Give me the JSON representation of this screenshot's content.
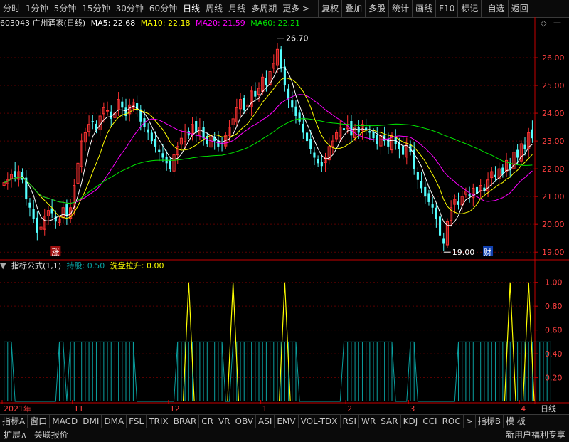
{
  "topbar": {
    "items": [
      "分时",
      "1分钟",
      "5分钟",
      "15分钟",
      "30分钟",
      "60分钟",
      "日线",
      "周线",
      "月线",
      "多周期",
      "更多 >"
    ],
    "active": "日线",
    "right_items": [
      "复权",
      "叠加",
      "多股",
      "统计",
      "画线",
      "F10",
      "标记",
      "-自选",
      "返回"
    ],
    "diamond_icon": "diamond-icon",
    "minimize_icon": "minimize-icon"
  },
  "info": {
    "code_name": "603043 广州酒家(日线)",
    "ma5": "MA5: 22.68",
    "ma10": "MA10: 22.18",
    "ma20": "MA20: 21.59",
    "ma60": "MA60: 22.21"
  },
  "indicator": {
    "name": "指标公式(1,1)",
    "hold_label": "持股: 0.50",
    "wash_label": "洗盘拉升: 0.00"
  },
  "markers": {
    "zhang": "涨",
    "cai": "财",
    "high": "26.70",
    "low": "19.00"
  },
  "colors": {
    "up": "#ff3232",
    "down": "#54ffff",
    "ma5": "#ffffff",
    "ma10": "#ffff00",
    "ma20": "#ff00ff",
    "ma60": "#00e600",
    "axis": "#c80000",
    "grid": "#5a0000",
    "hold": "#0aa0a0",
    "wash": "#ffff00"
  },
  "chart_data": {
    "type": "candlestick",
    "price_axis": {
      "ticks": [
        "26.00",
        "25.00",
        "24.00",
        "23.00",
        "22.00",
        "21.00",
        "20.00",
        "19.00"
      ],
      "range": [
        18.8,
        27.0
      ]
    },
    "indicator_axis": {
      "ticks": [
        "1.00",
        "0.80",
        "0.60",
        "0.40",
        "0.20"
      ],
      "range": [
        0,
        1.1
      ]
    },
    "time_labels": [
      "2021年",
      "11",
      "12",
      "1",
      "2",
      "3",
      "4"
    ],
    "time_label_index": [
      0,
      19,
      45,
      70,
      93,
      110,
      140
    ],
    "close_series": [
      21.5,
      21.6,
      21.8,
      21.7,
      21.9,
      21.6,
      20.9,
      20.6,
      20.2,
      19.7,
      19.9,
      20.3,
      20.5,
      20.4,
      20.1,
      20.2,
      20.6,
      20.3,
      20.6,
      21.4,
      22.2,
      23.0,
      23.3,
      23.6,
      23.7,
      23.4,
      23.9,
      24.2,
      24.1,
      23.8,
      24.0,
      24.5,
      24.2,
      23.9,
      24.3,
      24.4,
      24.1,
      23.7,
      23.5,
      23.3,
      23.0,
      22.8,
      22.6,
      22.4,
      22.2,
      22.0,
      22.5,
      22.8,
      23.1,
      23.4,
      23.2,
      23.6,
      23.3,
      23.5,
      23.1,
      22.9,
      23.2,
      23.0,
      22.8,
      22.9,
      23.2,
      23.5,
      23.8,
      24.2,
      24.5,
      24.1,
      24.3,
      24.8,
      24.6,
      24.9,
      25.3,
      25.0,
      25.5,
      25.8,
      26.3,
      25.6,
      25.0,
      24.5,
      24.2,
      23.9,
      23.7,
      23.3,
      23.0,
      22.7,
      22.4,
      22.2,
      22.1,
      22.4,
      22.8,
      23.0,
      23.3,
      23.5,
      23.4,
      23.6,
      23.2,
      23.5,
      23.3,
      23.6,
      23.4,
      23.3,
      23.1,
      22.9,
      23.2,
      23.0,
      22.8,
      23.2,
      22.9,
      22.7,
      22.5,
      22.9,
      22.6,
      22.0,
      21.6,
      21.3,
      21.0,
      20.8,
      20.6,
      20.2,
      19.6,
      19.3,
      20.1,
      20.6,
      20.9,
      20.7,
      21.0,
      21.2,
      21.0,
      21.3,
      21.1,
      21.4,
      21.2,
      21.6,
      21.9,
      21.7,
      22.0,
      21.8,
      22.3,
      22.0,
      22.6,
      22.4,
      22.9,
      22.7,
      23.3,
      23.1
    ],
    "hold_series": [
      0.5,
      0.5,
      0.5,
      0,
      0,
      0,
      0,
      0,
      0,
      0,
      0,
      0,
      0,
      0,
      0,
      0.5,
      0.5,
      0,
      0.5,
      0.5,
      0.5,
      0.5,
      0.5,
      0.5,
      0.5,
      0.5,
      0.5,
      0.5,
      0.5,
      0.5,
      0.5,
      0.5,
      0.5,
      0.5,
      0.5,
      0.5,
      0,
      0,
      0,
      0,
      0,
      0,
      0,
      0,
      0,
      0,
      0,
      0.5,
      0.5,
      0.5,
      0.5,
      0.5,
      0.5,
      0.5,
      0.5,
      0.5,
      0.5,
      0.5,
      0.5,
      0.5,
      0,
      0,
      0.5,
      0.5,
      0.5,
      0.5,
      0.5,
      0.5,
      0.5,
      0.5,
      0.5,
      0.5,
      0.5,
      0.5,
      0.5,
      0.5,
      0.5,
      0.5,
      0.5,
      0.5,
      0,
      0,
      0,
      0,
      0,
      0,
      0,
      0,
      0,
      0,
      0,
      0,
      0.5,
      0.5,
      0.5,
      0.5,
      0.5,
      0.5,
      0.5,
      0.5,
      0.5,
      0.5,
      0.5,
      0.5,
      0.5,
      0.5,
      0,
      0,
      0,
      0,
      0.5,
      0.5,
      0,
      0,
      0,
      0,
      0,
      0,
      0,
      0,
      0,
      0,
      0,
      0.5,
      0.5,
      0.5,
      0.5,
      0.5,
      0.5,
      0.5,
      0.5,
      0.5,
      0.5,
      0.5,
      0.5,
      0.5,
      0.5,
      0.5,
      0.5,
      0.5,
      0.5,
      0.5,
      0.5,
      0.5,
      0.5,
      0.5,
      0.5,
      0.5,
      0.5
    ],
    "wash_index": [
      50,
      62,
      76,
      137,
      142
    ]
  },
  "timebar": {
    "right_label": "日线"
  },
  "tabs": [
    "指标A",
    "窗口",
    "MACD",
    "DMI",
    "DMA",
    "FSL",
    "TRIX",
    "BRAR",
    "CR",
    "VR",
    "OBV",
    "ASI",
    "EMV",
    "VOL-TDX",
    "RSI",
    "WR",
    "SAR",
    "KDJ",
    "CCI",
    "ROC",
    ">",
    "指标B",
    "模 板"
  ],
  "bottom": {
    "expand": "扩展∧",
    "related": "关联报价",
    "right": "新用户福利专享"
  }
}
